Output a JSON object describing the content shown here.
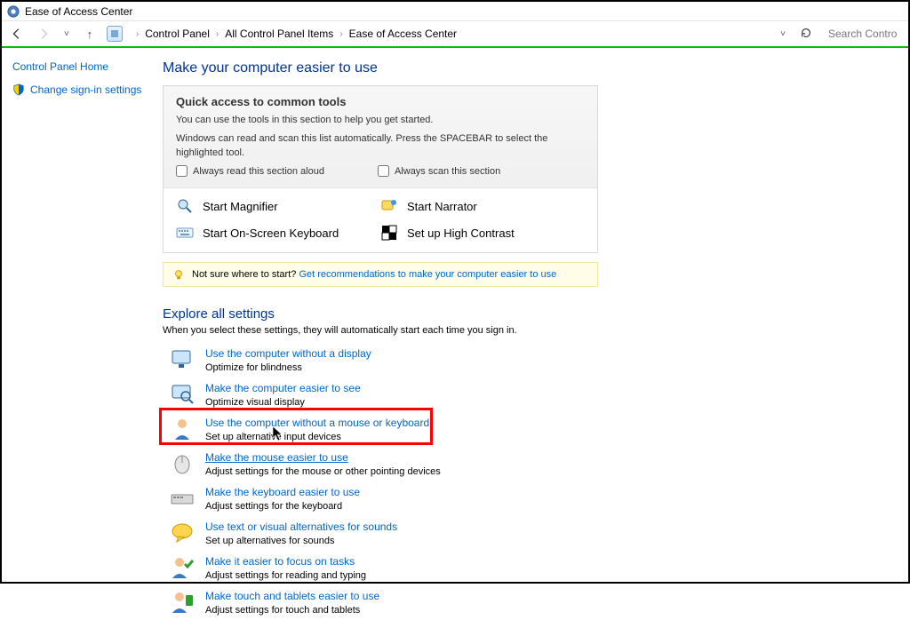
{
  "window": {
    "title": "Ease of Access Center"
  },
  "breadcrumb": {
    "items": [
      "Control Panel",
      "All Control Panel Items",
      "Ease of Access Center"
    ]
  },
  "search": {
    "placeholder": "Search Control Panel"
  },
  "sidebar": {
    "home": "Control Panel Home",
    "signin": "Change sign-in settings"
  },
  "main": {
    "title": "Make your computer easier to use",
    "quick": {
      "heading": "Quick access to common tools",
      "line1": "You can use the tools in this section to help you get started.",
      "line2": "Windows can read and scan this list automatically.  Press the SPACEBAR to select the highlighted tool.",
      "chk1": "Always read this section aloud",
      "chk2": "Always scan this section",
      "tools": {
        "magnifier": "Start Magnifier",
        "narrator": "Start Narrator",
        "osk": "Start On-Screen Keyboard",
        "contrast": "Set up High Contrast"
      }
    },
    "hint": {
      "prefix": "Not sure where to start? ",
      "link": "Get recommendations to make your computer easier to use"
    },
    "explore": {
      "heading": "Explore all settings",
      "sub": "When you select these settings, they will automatically start each time you sign in.",
      "items": [
        {
          "title": "Use the computer without a display",
          "desc": "Optimize for blindness"
        },
        {
          "title": "Make the computer easier to see",
          "desc": "Optimize visual display"
        },
        {
          "title": "Use the computer without a mouse or keyboard",
          "desc": "Set up alternative input devices"
        },
        {
          "title": "Make the mouse easier to use",
          "desc": "Adjust settings for the mouse or other pointing devices"
        },
        {
          "title": "Make the keyboard easier to use",
          "desc": "Adjust settings for the keyboard"
        },
        {
          "title": "Use text or visual alternatives for sounds",
          "desc": "Set up alternatives for sounds"
        },
        {
          "title": "Make it easier to focus on tasks",
          "desc": "Adjust settings for reading and typing"
        },
        {
          "title": "Make touch and tablets easier to use",
          "desc": "Adjust settings for touch and tablets"
        }
      ]
    }
  }
}
